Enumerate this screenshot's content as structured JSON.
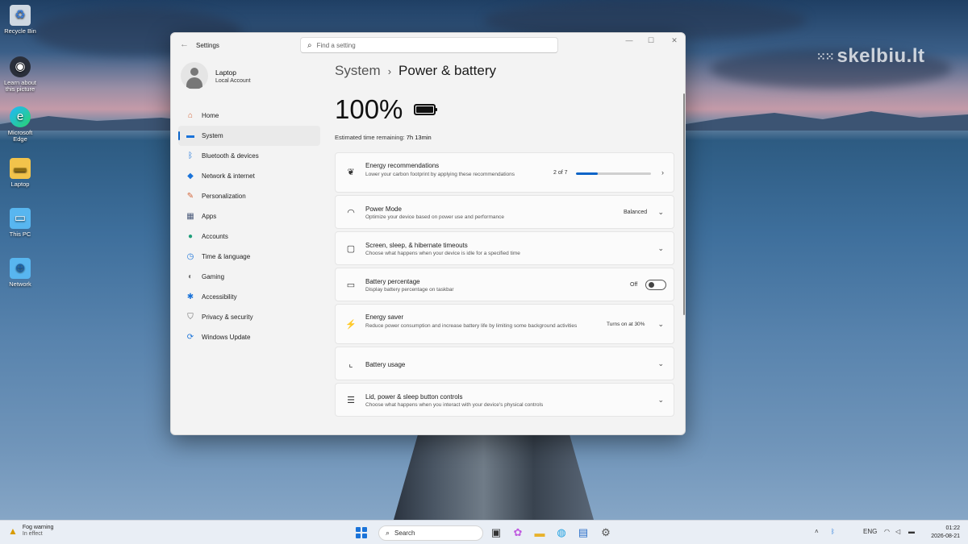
{
  "desktop": {
    "icons": [
      {
        "label": "Recycle Bin",
        "icon": "recycle-bin-icon"
      },
      {
        "label": "Learn about this picture",
        "icon": "camera-icon"
      },
      {
        "label": "Microsoft Edge",
        "icon": "edge-icon"
      },
      {
        "label": "Laptop",
        "icon": "folder-icon"
      },
      {
        "label": "This PC",
        "icon": "monitor-icon"
      },
      {
        "label": "Network",
        "icon": "network-icon"
      }
    ],
    "watermark": "skelbiu.lt"
  },
  "window": {
    "title": "Settings",
    "search_placeholder": "Find a setting",
    "controls": {
      "minimize": "—",
      "maximize": "☐",
      "close": "✕"
    }
  },
  "profile": {
    "name": "Laptop",
    "account": "Local Account"
  },
  "sidebar": {
    "items": [
      {
        "label": "Home",
        "icon": "home-icon",
        "color": "#d4663b"
      },
      {
        "label": "System",
        "icon": "system-icon",
        "color": "#1a73d9",
        "active": true
      },
      {
        "label": "Bluetooth & devices",
        "icon": "bluetooth-icon",
        "color": "#1a73d9"
      },
      {
        "label": "Network & internet",
        "icon": "wifi-icon",
        "color": "#1a73d9"
      },
      {
        "label": "Personalization",
        "icon": "brush-icon",
        "color": "#d4663b"
      },
      {
        "label": "Apps",
        "icon": "apps-icon",
        "color": "#4a5a7a"
      },
      {
        "label": "Accounts",
        "icon": "person-icon",
        "color": "#1f9e7a"
      },
      {
        "label": "Time & language",
        "icon": "globe-clock-icon",
        "color": "#1a73d9"
      },
      {
        "label": "Gaming",
        "icon": "gamepad-icon",
        "color": "#777777"
      },
      {
        "label": "Accessibility",
        "icon": "accessibility-icon",
        "color": "#1a73d9"
      },
      {
        "label": "Privacy & security",
        "icon": "shield-icon",
        "color": "#666666"
      },
      {
        "label": "Windows Update",
        "icon": "update-icon",
        "color": "#1a73d9"
      }
    ]
  },
  "main": {
    "breadcrumb_root": "System",
    "breadcrumb_sep": "›",
    "page_title": "Power & battery",
    "battery_percent": "100%",
    "battery_level": 1.0,
    "estimated_label": "Estimated time remaining:",
    "estimated_value": "7h 13min",
    "cards": [
      {
        "title": "Energy recommendations",
        "desc": "Lower your carbon footprint by applying these recommendations",
        "value": "2 of 7",
        "progress": 0.29,
        "icon": "leaf-icon"
      },
      {
        "title": "Power Mode",
        "desc": "Optimize your device based on power use and performance",
        "value": "Balanced",
        "icon": "gauge-icon"
      },
      {
        "title": "Screen, sleep, & hibernate timeouts",
        "desc": "Choose what happens when your device is idle for a specified time",
        "value": "",
        "icon": "screen-sleep-icon"
      },
      {
        "title": "Battery percentage",
        "desc": "Display battery percentage on taskbar",
        "value": "Off",
        "toggle_on": false,
        "icon": "battery-percent-icon"
      },
      {
        "title": "Energy saver",
        "desc": "Reduce power consumption and increase battery life by limiting some background activities",
        "value": "Turns on at 30%",
        "icon": "energy-saver-icon"
      },
      {
        "title": "Battery usage",
        "desc": "",
        "value": "",
        "icon": "chart-icon"
      },
      {
        "title": "Lid, power & sleep button controls",
        "desc": "Choose what happens when you interact with your device's physical controls",
        "value": "",
        "icon": "list-icon"
      }
    ]
  },
  "taskbar": {
    "weather_title": "Fog warning",
    "weather_sub": "In effect",
    "search_placeholder": "Search",
    "tray_lang": "ENG",
    "time": "01:22",
    "date": "2026-08-21"
  }
}
